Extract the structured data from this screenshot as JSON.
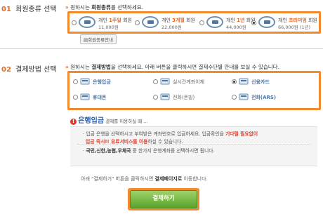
{
  "section1": {
    "num": "01",
    "title": "회원종류 선택",
    "prompt_arrow": "»",
    "prompt_pre": "원하시는 ",
    "prompt_bold": "회원종류",
    "prompt_post": "를 선택하세요.",
    "options": [
      {
        "name_pre": "개인 ",
        "name_hl": "1주일",
        "name_post": " 회원",
        "price": "11,000원",
        "checked": false
      },
      {
        "name_pre": "개인 ",
        "name_hl": "3개월",
        "name_post": " 회원",
        "price": "22,000원",
        "checked": false
      },
      {
        "name_pre": "개인 ",
        "name_hl": "1년",
        "name_post": " 회원",
        "price": "44,000원",
        "checked": false
      },
      {
        "name_pre": "개인 ",
        "name_hl": "프리미엄",
        "name_post": " 회원",
        "price": "66,000원 (1년)",
        "checked": true
      }
    ],
    "guide_button": "회원종류안내"
  },
  "section2": {
    "num": "02",
    "title": "결제방법 선택",
    "prompt_arrow": "»",
    "prompt_pre": "원하시는 ",
    "prompt_bold": "결제방법",
    "prompt_post": "을 선택하세요. 아래 버튼을 클릭하시면 결제수단별 안내를 보실 수 있습니다.",
    "options": [
      {
        "label": "은행입금",
        "checked": false,
        "gray": false,
        "icon": "bank-icon"
      },
      {
        "label": "실시간계좌이체",
        "checked": false,
        "gray": true,
        "icon": "transfer-icon"
      },
      {
        "label": "신용카드",
        "checked": true,
        "gray": false,
        "icon": "card-icon"
      },
      {
        "label": "휴대폰",
        "checked": false,
        "gray": false,
        "icon": "mobile-icon"
      },
      {
        "label": "전화(폰빌)",
        "checked": false,
        "gray": true,
        "icon": "phone-icon"
      },
      {
        "label": "전화(ARS)",
        "checked": false,
        "gray": false,
        "icon": "ars-icon"
      }
    ]
  },
  "info": {
    "title": "은행입금",
    "subtitle": "결제를 이용하실 때 ...",
    "line1_pre": "입금 은행을 선택하시고 부여받은 계좌번호로 입금하세요. 입금확인을 ",
    "line1_red": "기다릴 필요없이",
    "line2_red": "입금 즉시!! 유료서비스를 이용",
    "line2_post": "하실 수 있습니다.",
    "line3_bold": "국민,신한,농협,우체국",
    "line3_post": " 중 한가지 은행계좌를 선택하시면 됩니다."
  },
  "footer": {
    "note_pre": "아래 \"결제하기\" 버튼을 클릭하시면 ",
    "note_bold": "결제페이지로",
    "note_post": " 이동합니다.",
    "submit_label": "결제하기"
  },
  "colors": {
    "accent": "#f08a2c",
    "brand_blue": "#4a76a8",
    "submit_green": "#6cb33c",
    "alert_red": "#e23b2b"
  }
}
